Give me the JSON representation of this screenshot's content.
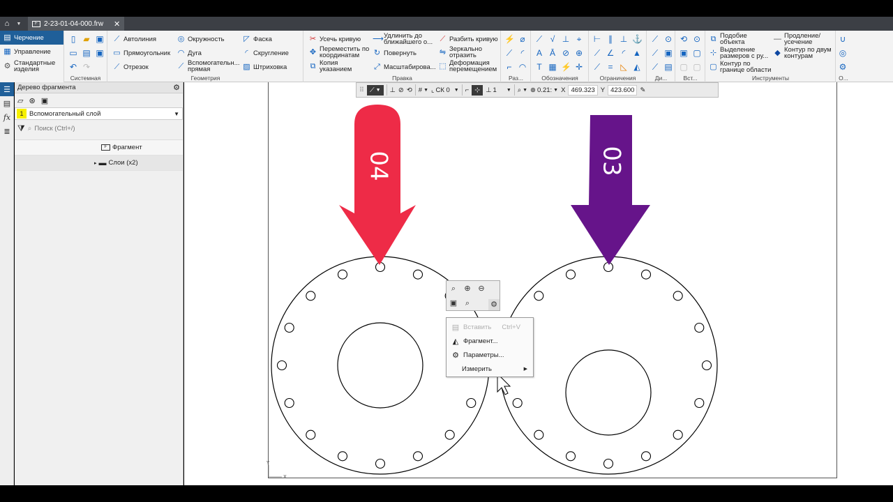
{
  "tab": {
    "filename": "2-23-01-04-000.frw",
    "close": "✕"
  },
  "modes": [
    {
      "label": "Черчение"
    },
    {
      "label": "Управление"
    },
    {
      "label": "Стандартные изделия"
    }
  ],
  "ribbon": {
    "groups": {
      "system": "Системная",
      "geometry": "Геометрия",
      "edit": "Правка",
      "dims": "Раз...",
      "marks": "Обозначения",
      "constraints": "Ограничения",
      "di": "Ди...",
      "insert": "Вст...",
      "tools": "Инструменты",
      "o": "О..."
    },
    "geometry": {
      "autoline": "Автолиния",
      "rectangle": "Прямоугольник",
      "segment": "Отрезок",
      "circle": "Окружность",
      "arc": "Дуга",
      "aux_line": "Вспомогательн... прямая",
      "chamfer": "Фаска",
      "fillet": "Скругление",
      "hatch": "Штриховка"
    },
    "edit": {
      "trim": "Усечь кривую",
      "move": "Переместить по координатам",
      "copy": "Копия указанием",
      "extend": "Удлинить до ближайшего о...",
      "rotate": "Повернуть",
      "scale": "Масштабирова...",
      "split": "Разбить кривую",
      "mirror": "Зеркально отразить",
      "deform": "Деформация перемещением"
    },
    "tools": {
      "similar": "Подобие объекта",
      "select_dims": "Выделение размеров с ру...",
      "contour_boundary": "Контур по границе области",
      "extend_trim": "Продление/ усечение",
      "contour_two": "Контур по двум контурам"
    }
  },
  "panel": {
    "title": "Дерево фрагмента",
    "layer_num": "1",
    "layer_name": "Вспомогательный слой",
    "search_placeholder": "Поиск (Ctrl+/)",
    "tree": [
      {
        "label": "Фрагмент"
      },
      {
        "label": "Слои (x2)"
      }
    ]
  },
  "cad_toolbar": {
    "cs": "СК 0",
    "step": "1",
    "zoom": "0.21:",
    "x_label": "X",
    "x_value": "469.323",
    "y_label": "Y",
    "y_value": "423.600"
  },
  "drawing": {
    "arrow_left_label": "04",
    "arrow_right_label": "03",
    "arrow_left_color": "#ee2b47",
    "arrow_right_color": "#66148a",
    "axis_y": "Y",
    "axis_x": "X"
  },
  "context_menu": {
    "paste": "Вставить",
    "paste_shortcut": "Ctrl+V",
    "fragment": "Фрагмент...",
    "params": "Параметры...",
    "measure": "Измерить"
  }
}
